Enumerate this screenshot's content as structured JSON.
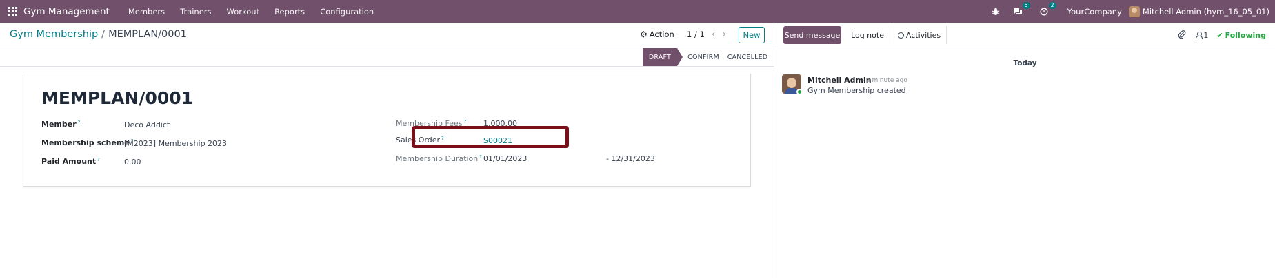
{
  "navbar": {
    "app_title": "Gym Management",
    "menu": [
      "Members",
      "Trainers",
      "Workout",
      "Reports",
      "Configuration"
    ],
    "messages_count": "5",
    "activities_count": "2",
    "company": "YourCompany",
    "user": "Mitchell Admin (hym_16_05_01)"
  },
  "control": {
    "breadcrumb_parent": "Gym Membership",
    "breadcrumb_separator": "/",
    "breadcrumb_current": "MEMPLAN/0001",
    "action_label": "Action",
    "pager": "1 / 1",
    "new_label": "New"
  },
  "status": {
    "stages": [
      "DRAFT",
      "CONFIRM",
      "CANCELLED"
    ],
    "active": "DRAFT"
  },
  "form": {
    "title": "MEMPLAN/0001",
    "member_label": "Member",
    "member_value": "Deco Addict",
    "scheme_label": "Membership scheme",
    "scheme_value": "[M2023] Membership 2023",
    "paid_label": "Paid Amount",
    "paid_value": "0.00",
    "fees_label": "Membership Fees",
    "fees_value": "1,000.00",
    "sales_order_label": "Sales Order",
    "sales_order_value": "S00021",
    "duration_label": "Membership Duration",
    "duration_start": "01/01/2023",
    "duration_end": "- 12/31/2023",
    "tooltip_mark": "?"
  },
  "chatter": {
    "send_message": "Send message",
    "log_note": "Log note",
    "activities": "Activities",
    "followers_count": "1",
    "following": "Following",
    "date_separator": "Today",
    "message": {
      "author": "Mitchell Admin",
      "time": "- a minute ago",
      "body": "Gym Membership created"
    }
  },
  "colors": {
    "brand": "#71506b",
    "accent": "#017e84",
    "highlight": "#7a0f1a",
    "following": "#28a745"
  }
}
